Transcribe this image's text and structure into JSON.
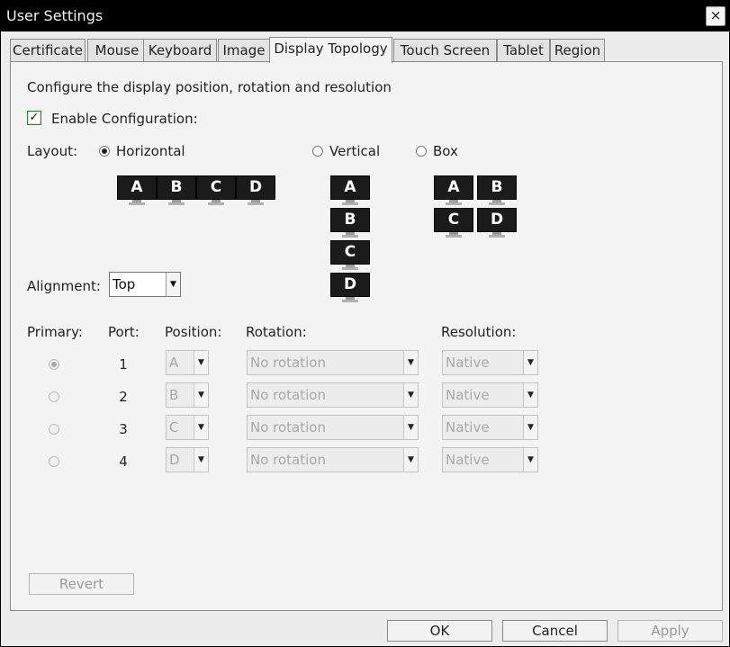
{
  "window": {
    "title": "User Settings",
    "close_glyph": "×"
  },
  "tabs": [
    {
      "label": "Certificate"
    },
    {
      "label": "Mouse"
    },
    {
      "label": "Keyboard"
    },
    {
      "label": "Image"
    },
    {
      "label": "Display Topology"
    },
    {
      "label": "Touch Screen"
    },
    {
      "label": "Tablet"
    },
    {
      "label": "Region"
    }
  ],
  "panel": {
    "description": "Configure the display position, rotation and resolution",
    "enable_config": {
      "label": "Enable Configuration:",
      "checked": true,
      "glyph": "✓"
    },
    "layout": {
      "label": "Layout:",
      "options": [
        {
          "label": "Horizontal",
          "selected": true
        },
        {
          "label": "Vertical",
          "selected": false
        },
        {
          "label": "Box",
          "selected": false
        }
      ],
      "monitor_letters": [
        "A",
        "B",
        "C",
        "D"
      ]
    },
    "alignment": {
      "label": "Alignment:",
      "value": "Top"
    },
    "table": {
      "headers": {
        "primary": "Primary:",
        "port": "Port:",
        "position": "Position:",
        "rotation": "Rotation:",
        "resolution": "Resolution:"
      },
      "rows": [
        {
          "port": "1",
          "position": "A",
          "rotation": "No rotation",
          "resolution": "Native",
          "primary": true
        },
        {
          "port": "2",
          "position": "B",
          "rotation": "No rotation",
          "resolution": "Native",
          "primary": false
        },
        {
          "port": "3",
          "position": "C",
          "rotation": "No rotation",
          "resolution": "Native",
          "primary": false
        },
        {
          "port": "4",
          "position": "D",
          "rotation": "No rotation",
          "resolution": "Native",
          "primary": false
        }
      ]
    },
    "revert_label": "Revert"
  },
  "footer": {
    "ok_label": "OK",
    "cancel_label": "Cancel",
    "apply_label": "Apply"
  },
  "icons": {
    "dropdown_arrow": "▼"
  }
}
